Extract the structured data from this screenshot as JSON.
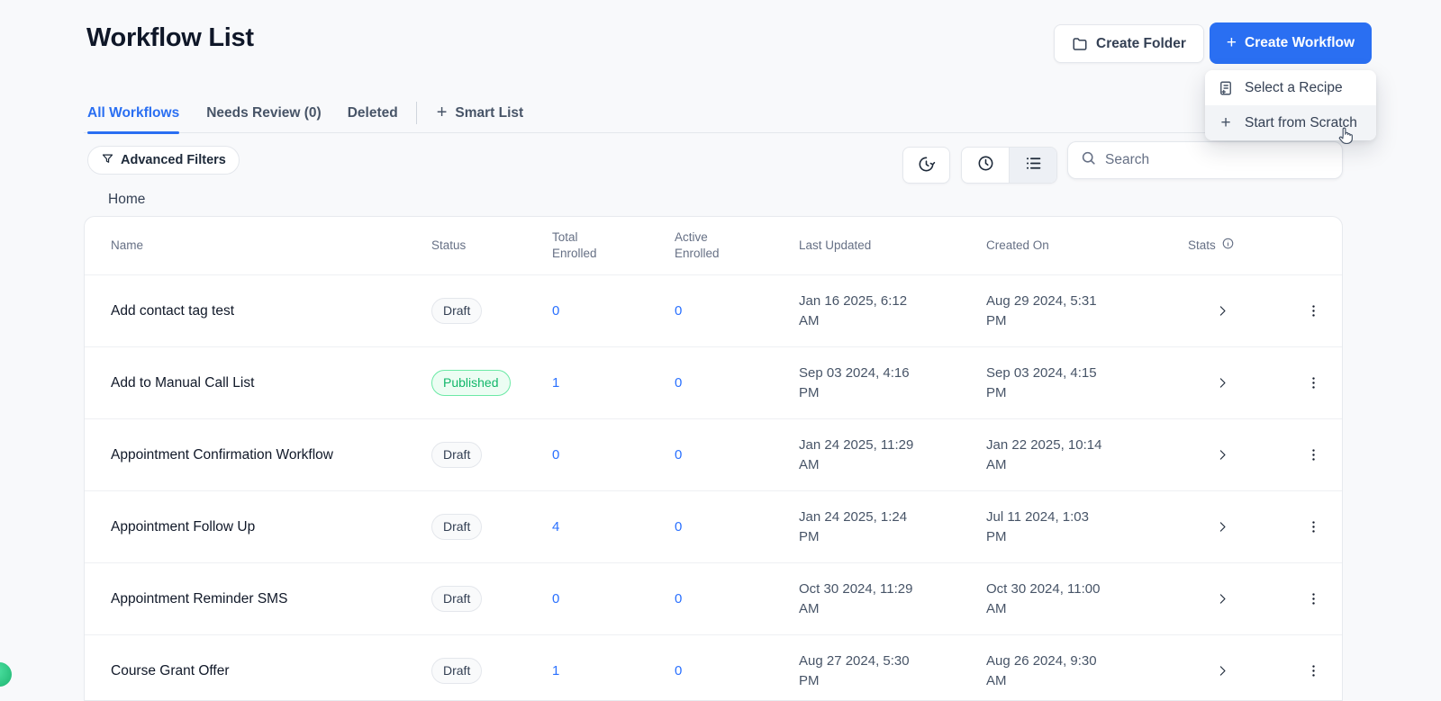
{
  "page": {
    "title": "Workflow List",
    "breadcrumb": "Home"
  },
  "header": {
    "create_folder_label": "Create Folder",
    "create_workflow_label": "Create Workflow",
    "create_workflow_plus": "+"
  },
  "dropdown": {
    "items": [
      {
        "label": "Select a Recipe",
        "icon": "recipe-icon"
      },
      {
        "label": "Start from Scratch",
        "icon": "plus-icon",
        "highlighted": true
      }
    ],
    "plus_glyph": "+"
  },
  "tabs": [
    {
      "label": "All Workflows",
      "active": true
    },
    {
      "label": "Needs Review (0)",
      "active": false
    },
    {
      "label": "Deleted",
      "active": false
    }
  ],
  "smart_list": {
    "label": "Smart List",
    "plus_glyph": "+"
  },
  "filters": {
    "advanced_filters_label": "Advanced Filters"
  },
  "toolbar": {
    "icons": [
      "history-icon",
      "clock-icon",
      "list-view-icon"
    ],
    "search_placeholder": "Search"
  },
  "table": {
    "columns": [
      "Name",
      "Status",
      "Total Enrolled",
      "Active Enrolled",
      "Last Updated",
      "Created On",
      "Stats"
    ],
    "rows": [
      {
        "name": "Add contact tag test",
        "status": "Draft",
        "total_enrolled": "0",
        "active_enrolled": "0",
        "last_updated": "Jan 16 2025, 6:12 AM",
        "created_on": "Aug 29 2024, 5:31 PM"
      },
      {
        "name": "Add to Manual Call List",
        "status": "Published",
        "total_enrolled": "1",
        "active_enrolled": "0",
        "last_updated": "Sep 03 2024, 4:16 PM",
        "created_on": "Sep 03 2024, 4:15 PM"
      },
      {
        "name": "Appointment Confirmation Workflow",
        "status": "Draft",
        "total_enrolled": "0",
        "active_enrolled": "0",
        "last_updated": "Jan 24 2025, 11:29 AM",
        "created_on": "Jan 22 2025, 10:14 AM"
      },
      {
        "name": "Appointment Follow Up",
        "status": "Draft",
        "total_enrolled": "4",
        "active_enrolled": "0",
        "last_updated": "Jan 24 2025, 1:24 PM",
        "created_on": "Jul 11 2024, 1:03 PM"
      },
      {
        "name": "Appointment Reminder SMS",
        "status": "Draft",
        "total_enrolled": "0",
        "active_enrolled": "0",
        "last_updated": "Oct 30 2024, 11:29 AM",
        "created_on": "Oct 30 2024, 11:00 AM"
      },
      {
        "name": "Course Grant Offer",
        "status": "Draft",
        "total_enrolled": "1",
        "active_enrolled": "0",
        "last_updated": "Aug 27 2024, 5:30 PM",
        "created_on": "Aug 26 2024, 9:30 AM"
      }
    ]
  },
  "colors": {
    "accent_blue": "#2a6ff2",
    "link_blue": "#2970ff",
    "published_green": "#12b76a",
    "published_bg": "#ecfdf3",
    "page_bg": "#f8f9fb"
  }
}
